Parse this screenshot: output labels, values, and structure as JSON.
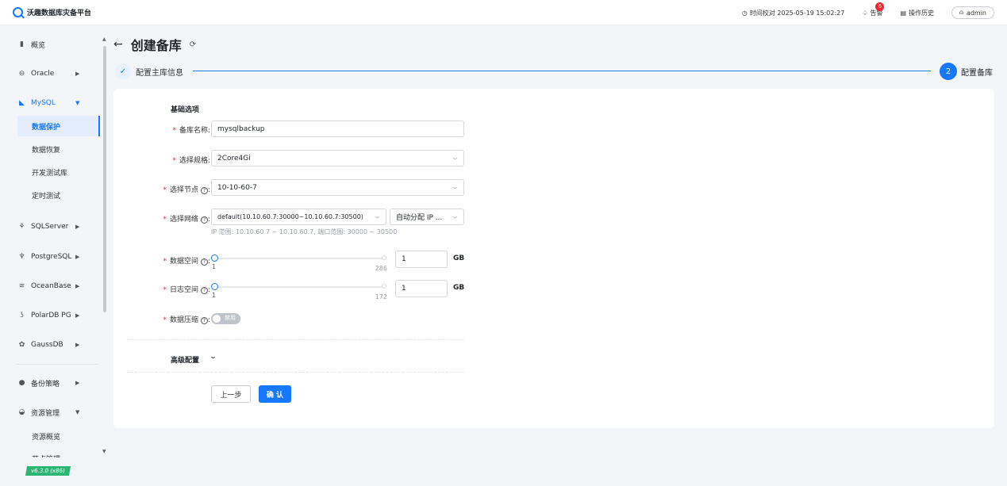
{
  "app": {
    "title": "沃趣数据库灾备平台"
  },
  "topbar": {
    "time_label": "时间校对 2025-05-19 15:02:27",
    "alerts_label": "告警",
    "alerts_count": "6",
    "history_label": "操作历史",
    "user": "admin"
  },
  "sidebar": {
    "items": [
      {
        "label": "概览",
        "icon": "bar-chart-icon"
      },
      {
        "label": "Oracle",
        "icon": "database-icon"
      },
      {
        "label": "MySQL",
        "icon": "mysql-icon"
      },
      {
        "label": "SQLServer",
        "icon": "sqlserver-icon"
      },
      {
        "label": "PostgreSQL",
        "icon": "postgresql-icon"
      },
      {
        "label": "OceanBase",
        "icon": "oceanbase-icon"
      },
      {
        "label": "PolarDB PG",
        "icon": "polardb-icon"
      },
      {
        "label": "GaussDB",
        "icon": "gaussdb-icon"
      },
      {
        "label": "备份策略",
        "icon": "strategy-icon"
      },
      {
        "label": "资源管理",
        "icon": "resource-icon"
      }
    ],
    "mysql_sub": [
      "数据保护",
      "数据恢复",
      "开发测试库",
      "定时测试"
    ],
    "resource_sub": [
      "资源概览",
      "节点管理"
    ],
    "version": "v6.3.0 (x86)"
  },
  "page": {
    "title": "创建备库",
    "steps": [
      {
        "label": "配置主库信息",
        "status": "done"
      },
      {
        "label": "配置备库",
        "number": "2",
        "status": "current"
      }
    ]
  },
  "form": {
    "section_basic": "基础选项",
    "name_label": "备库名称:",
    "name_value": "mysqlbackup",
    "spec_label": "选择规格:",
    "spec_value": "2Core4Gi",
    "node_label": "选择节点",
    "node_value": "10-10-60-7",
    "network_label": "选择网络",
    "network_value": "default(10.10.60.7:30000~10.10.60.7:30500)",
    "ip_value": "自动分配 IP ...",
    "network_hint": "IP 范围: 10.10.60.7 ~ 10.10.60.7, 端口范围: 30000 ~ 30500",
    "data_space_label": "数据空间",
    "data_space_min": "1",
    "data_space_max": "286",
    "data_space_value": "1",
    "log_space_label": "日志空间",
    "log_space_min": "1",
    "log_space_max": "172",
    "log_space_value": "1",
    "unit": "GB",
    "compress_label": "数据压缩",
    "compress_state": "禁用",
    "advanced_label": "高级配置",
    "prev_button": "上一步",
    "confirm_button": "确 认",
    "colon": ":"
  },
  "colors": {
    "accent": "#1677ff",
    "required": "#f5222d",
    "version_badge": "#2bb673"
  }
}
